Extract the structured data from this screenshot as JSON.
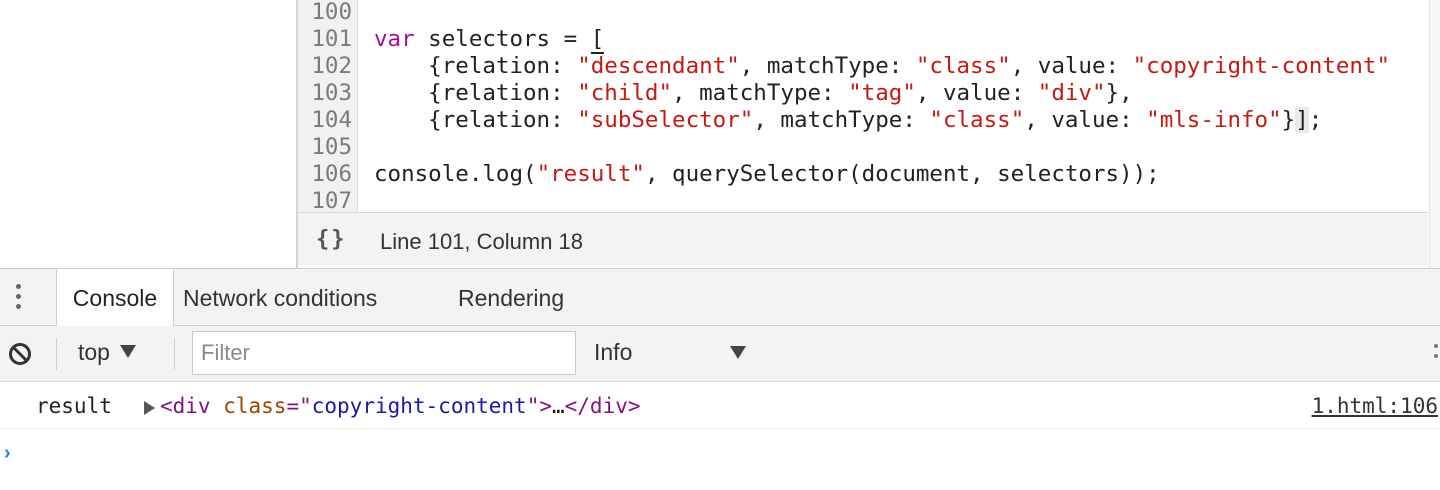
{
  "editor": {
    "lines": [
      {
        "num": "100",
        "segments": []
      },
      {
        "num": "101",
        "segments": [
          {
            "t": "var",
            "c": "kw"
          },
          {
            "t": " selectors = ",
            "c": "prop"
          },
          {
            "t": "[",
            "c": "bracket"
          }
        ]
      },
      {
        "num": "102",
        "segments": [
          {
            "t": "    {relation: ",
            "c": "prop"
          },
          {
            "t": "\"descendant\"",
            "c": "str"
          },
          {
            "t": ", matchType: ",
            "c": "prop"
          },
          {
            "t": "\"class\"",
            "c": "str"
          },
          {
            "t": ", value: ",
            "c": "prop"
          },
          {
            "t": "\"copyright-content\"",
            "c": "str"
          }
        ]
      },
      {
        "num": "103",
        "segments": [
          {
            "t": "    {relation: ",
            "c": "prop"
          },
          {
            "t": "\"child\"",
            "c": "str"
          },
          {
            "t": ", matchType: ",
            "c": "prop"
          },
          {
            "t": "\"tag\"",
            "c": "str"
          },
          {
            "t": ", value: ",
            "c": "prop"
          },
          {
            "t": "\"div\"",
            "c": "str"
          },
          {
            "t": "},",
            "c": "prop"
          }
        ]
      },
      {
        "num": "104",
        "segments": [
          {
            "t": "    {relation: ",
            "c": "prop"
          },
          {
            "t": "\"subSelector\"",
            "c": "str"
          },
          {
            "t": ", matchType: ",
            "c": "prop"
          },
          {
            "t": "\"class\"",
            "c": "str"
          },
          {
            "t": ", value: ",
            "c": "prop"
          },
          {
            "t": "\"mls-info\"",
            "c": "str"
          },
          {
            "t": "}",
            "c": "prop"
          },
          {
            "t": "]",
            "c": "bracket2"
          },
          {
            "t": ";",
            "c": "prop"
          }
        ]
      },
      {
        "num": "105",
        "segments": []
      },
      {
        "num": "106",
        "segments": [
          {
            "t": "console.log(",
            "c": "prop"
          },
          {
            "t": "\"result\"",
            "c": "str"
          },
          {
            "t": ", querySelector(document, selectors));",
            "c": "prop"
          }
        ]
      },
      {
        "num": "107",
        "segments": []
      }
    ],
    "status": {
      "braces": "{}",
      "position": "Line 101, Column 18"
    }
  },
  "drawer": {
    "tabs": [
      {
        "label": "Console",
        "active": true
      },
      {
        "label": "Network conditions",
        "active": false
      },
      {
        "label": "Rendering",
        "active": false
      }
    ]
  },
  "console_toolbar": {
    "context": "top",
    "filter_placeholder": "Filter",
    "level": "Info"
  },
  "messages": [
    {
      "label": "result",
      "node": {
        "open_tag": "<div",
        "attr_name": "class",
        "attr_eq": "=\"",
        "attr_value": "copyright-content",
        "attr_close": "\">",
        "ellipsis": "…",
        "close_tag": "</div>"
      },
      "source": "1.html:106"
    }
  ],
  "prompt": "›",
  "colors": {
    "keyword": "#aa0d91",
    "string": "#c41a16",
    "tag": "#881280",
    "attr": "#994500",
    "attr_value": "#1a1aa6",
    "prompt": "#2f7bff"
  }
}
